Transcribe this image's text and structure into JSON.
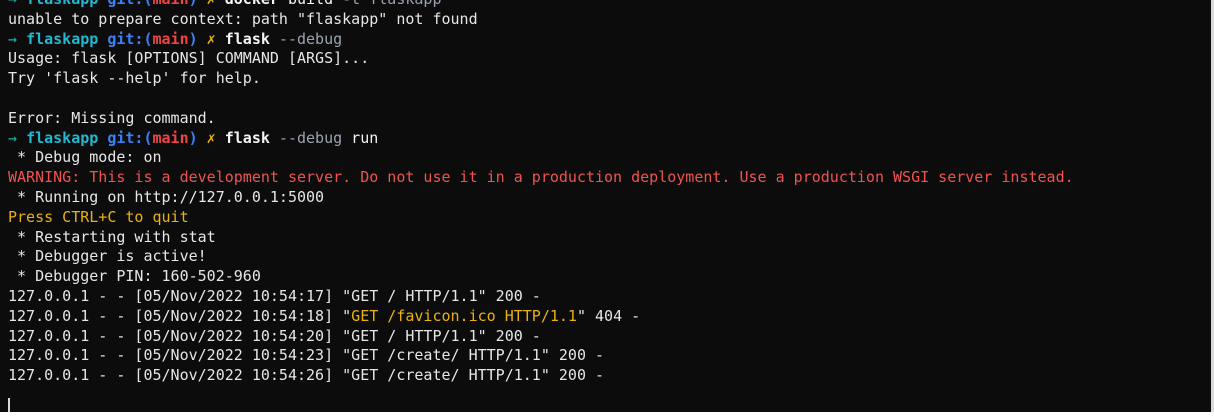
{
  "colors": {
    "background": "#0c0c0c",
    "prompt_arrow": "#14b8a6",
    "prompt_dir": "#22b8cf",
    "prompt_git": "#3b82f6",
    "prompt_branch": "#ef4444",
    "prompt_dirty": "#eab308",
    "warning": "#ef5350",
    "quit_hint": "#eab308"
  },
  "terminal": {
    "lines": [
      {
        "segments": [
          {
            "text": "→ ",
            "cls": "c-arrow"
          },
          {
            "text": "flaskapp ",
            "cls": "c-dir"
          },
          {
            "text": "git:(",
            "cls": "c-git"
          },
          {
            "text": "main",
            "cls": "c-branch"
          },
          {
            "text": ")",
            "cls": "c-git"
          },
          {
            "text": " ✗ ",
            "cls": "c-x"
          },
          {
            "text": "docker",
            "cls": "c-cmd"
          },
          {
            "text": " build ",
            "cls": "c-arg"
          },
          {
            "text": "-t flaskapp",
            "cls": "c-flag"
          }
        ]
      },
      {
        "segments": [
          {
            "text": "unable to prepare context: path \"flaskapp\" not found",
            "cls": "c-white"
          }
        ]
      },
      {
        "segments": [
          {
            "text": "→ ",
            "cls": "c-arrow"
          },
          {
            "text": "flaskapp ",
            "cls": "c-dir"
          },
          {
            "text": "git:(",
            "cls": "c-git"
          },
          {
            "text": "main",
            "cls": "c-branch"
          },
          {
            "text": ")",
            "cls": "c-git"
          },
          {
            "text": " ✗ ",
            "cls": "c-x"
          },
          {
            "text": "flask",
            "cls": "c-cmd"
          },
          {
            "text": " --debug",
            "cls": "c-flag"
          }
        ]
      },
      {
        "segments": [
          {
            "text": "Usage: flask [OPTIONS] COMMAND [ARGS]...",
            "cls": "c-white"
          }
        ]
      },
      {
        "segments": [
          {
            "text": "Try 'flask --help' for help.",
            "cls": "c-white"
          }
        ]
      },
      {
        "segments": [
          {
            "text": "",
            "cls": "c-white"
          }
        ]
      },
      {
        "segments": [
          {
            "text": "Error: Missing command.",
            "cls": "c-white"
          }
        ]
      },
      {
        "segments": [
          {
            "text": "→ ",
            "cls": "c-arrow"
          },
          {
            "text": "flaskapp ",
            "cls": "c-dir"
          },
          {
            "text": "git:(",
            "cls": "c-git"
          },
          {
            "text": "main",
            "cls": "c-branch"
          },
          {
            "text": ")",
            "cls": "c-git"
          },
          {
            "text": " ✗ ",
            "cls": "c-x"
          },
          {
            "text": "flask",
            "cls": "c-cmd"
          },
          {
            "text": " --debug",
            "cls": "c-flag"
          },
          {
            "text": " run",
            "cls": "c-arg"
          }
        ]
      },
      {
        "segments": [
          {
            "text": " * Debug mode: on",
            "cls": "c-white"
          }
        ]
      },
      {
        "segments": [
          {
            "text": "WARNING: This is a development server. Do not use it in a production deployment. Use a production WSGI server instead.",
            "cls": "c-red"
          }
        ]
      },
      {
        "segments": [
          {
            "text": " * Running on http://127.0.0.1:5000",
            "cls": "c-white"
          }
        ]
      },
      {
        "segments": [
          {
            "text": "Press CTRL+C to quit",
            "cls": "c-yellow"
          }
        ]
      },
      {
        "segments": [
          {
            "text": " * Restarting with stat",
            "cls": "c-white"
          }
        ]
      },
      {
        "segments": [
          {
            "text": " * Debugger is active!",
            "cls": "c-white"
          }
        ]
      },
      {
        "segments": [
          {
            "text": " * Debugger PIN: 160-502-960",
            "cls": "c-white"
          }
        ]
      },
      {
        "segments": [
          {
            "text": "127.0.0.1 - - [05/Nov/2022 10:54:17] \"GET / HTTP/1.1\" 200 -",
            "cls": "c-white"
          }
        ]
      },
      {
        "segments": [
          {
            "text": "127.0.0.1 - - [05/Nov/2022 10:54:18] \"",
            "cls": "c-white"
          },
          {
            "text": "GET /favicon.ico HTTP/1.1",
            "cls": "c-yellow"
          },
          {
            "text": "\" 404 -",
            "cls": "c-white"
          }
        ]
      },
      {
        "segments": [
          {
            "text": "127.0.0.1 - - [05/Nov/2022 10:54:20] \"GET / HTTP/1.1\" 200 -",
            "cls": "c-white"
          }
        ]
      },
      {
        "segments": [
          {
            "text": "127.0.0.1 - - [05/Nov/2022 10:54:23] \"GET /create/ HTTP/1.1\" 200 -",
            "cls": "c-white"
          }
        ]
      },
      {
        "segments": [
          {
            "text": "127.0.0.1 - - [05/Nov/2022 10:54:26] \"GET /create/ HTTP/1.1\" 200 -",
            "cls": "c-white"
          }
        ]
      }
    ]
  }
}
